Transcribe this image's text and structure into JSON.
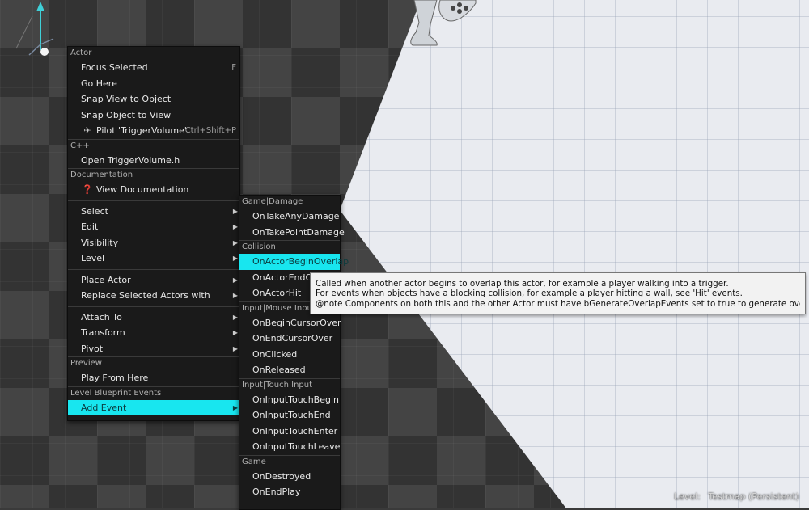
{
  "main_menu": {
    "actor_header": "Actor",
    "focus_selected": "Focus Selected",
    "focus_selected_shortcut": "F",
    "go_here": "Go Here",
    "snap_view": "Snap View to Object",
    "snap_object": "Snap Object to View",
    "pilot": "Pilot 'TriggerVolume'",
    "pilot_shortcut": "Ctrl+Shift+P",
    "cpp_header": "C++",
    "open_header": "Open TriggerVolume.h",
    "doc_header": "Documentation",
    "view_doc": "View Documentation",
    "select": "Select",
    "edit": "Edit",
    "visibility": "Visibility",
    "level": "Level",
    "place_actor": "Place Actor",
    "replace_actors": "Replace Selected Actors with",
    "attach_to": "Attach To",
    "transform": "Transform",
    "pivot": "Pivot",
    "preview_header": "Preview",
    "play_from_here": "Play From Here",
    "lbe_header": "Level Blueprint Events",
    "add_event": "Add Event"
  },
  "sub_menu": {
    "game_damage_header": "Game|Damage",
    "on_take_any_damage": "OnTakeAnyDamage",
    "on_take_point_damage": "OnTakePointDamage",
    "collision_header": "Collision",
    "on_actor_begin_overlap": "OnActorBeginOverlap",
    "on_actor_end_overlap": "OnActorEndOv",
    "on_actor_hit": "OnActorHit",
    "mouse_header": "Input|Mouse Input",
    "on_begin_cursor_over": "OnBeginCursorOver",
    "on_end_cursor_over": "OnEndCursorOver",
    "on_clicked": "OnClicked",
    "on_released": "OnReleased",
    "touch_header": "Input|Touch Input",
    "on_input_touch_begin": "OnInputTouchBegin",
    "on_input_touch_end": "OnInputTouchEnd",
    "on_input_touch_enter": "OnInputTouchEnter",
    "on_input_touch_leave": "OnInputTouchLeave",
    "game_header": "Game",
    "on_destroyed": "OnDestroyed",
    "on_end_play": "OnEndPlay"
  },
  "tooltip": {
    "line1": "Called when another actor begins to overlap this actor, for example a player walking into a trigger.",
    "line2": "For events when objects have a blocking collision, for example a player hitting a wall, see 'Hit' events.",
    "line3": "@note Components on both this and the other Actor must have bGenerateOverlapEvents set to true to generate overlap events."
  },
  "status": {
    "label": "Level:",
    "value": "Testmap (Persistent)"
  },
  "icons": {
    "pilot": "airplane-icon",
    "documentation": "help-circle-icon",
    "submenu": "chevron-right-icon"
  },
  "colors": {
    "highlight": "#18e6ef",
    "menu_bg": "#1a1a1a",
    "tooltip_bg": "#f2f2f2"
  }
}
